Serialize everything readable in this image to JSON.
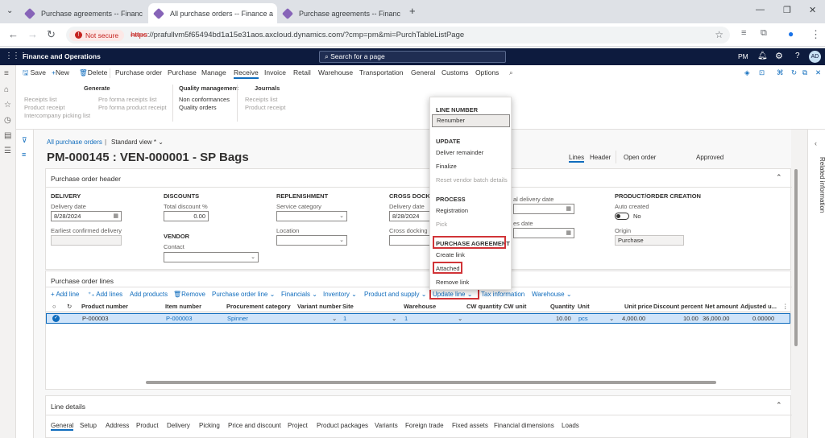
{
  "browser": {
    "tabs": [
      {
        "title": "Purchase agreements -- Financ"
      },
      {
        "title": "All purchase orders -- Finance a"
      },
      {
        "title": "Purchase agreements -- Financ"
      }
    ],
    "not_secure": "Not secure",
    "url_scheme": "https",
    "url_rest": "://prafullvm5f65494bd1a15e31aos.axcloud.dynamics.com/?cmp=pm&mi=PurchTableListPage"
  },
  "appbar": {
    "title": "Finance and Operations",
    "search_placeholder": "Search for a page",
    "company": "PM",
    "avatar": "AD"
  },
  "actions": {
    "save": "Save",
    "new": "New",
    "delete": "Delete",
    "tabs": [
      "Purchase order",
      "Purchase",
      "Manage",
      "Receive",
      "Invoice",
      "Retail",
      "Warehouse",
      "Transportation",
      "General",
      "Customs",
      "Options"
    ],
    "selected_tab": "Receive"
  },
  "ribbon": {
    "generate": {
      "title": "Generate",
      "items": [
        "Receipts list",
        "Product receipt",
        "Intercompany picking list",
        "Pro forma receipts list",
        "Pro forma product receipt"
      ]
    },
    "quality": {
      "title": "Quality management",
      "items": [
        "Non conformances",
        "Quality orders"
      ]
    },
    "journals": {
      "title": "Journals",
      "items": [
        "Receipts list",
        "Product receipt"
      ]
    }
  },
  "page": {
    "breadcrumb": "All purchase orders",
    "view": "Standard view *",
    "title": "PM-000145 : VEN-000001 - SP Bags",
    "view_lines": "Lines",
    "view_header": "Header",
    "status_open": "Open order",
    "status_approved": "Approved"
  },
  "header_section": {
    "title": "Purchase order header",
    "delivery": {
      "title": "DELIVERY",
      "date_label": "Delivery date",
      "date_value": "8/28/2024",
      "earliest_label": "Earliest confirmed delivery"
    },
    "discounts": {
      "title": "DISCOUNTS",
      "total_label": "Total discount %",
      "total_value": "0.00"
    },
    "vendor": {
      "title": "VENDOR",
      "contact_label": "Contact"
    },
    "replenishment": {
      "title": "REPLENISHMENT",
      "service_label": "Service category",
      "location_label": "Location"
    },
    "crossdock": {
      "title": "CROSS DOCKING",
      "date_label": "Delivery date",
      "date_value": "8/28/2024",
      "cd_label": "Cross docking d"
    },
    "confirmed": {
      "label1": "al delivery date",
      "label2": "es date"
    },
    "creation": {
      "title": "PRODUCT/ORDER CREATION",
      "auto_label": "Auto created",
      "auto_value": "No",
      "origin_label": "Origin",
      "origin_value": "Purchase"
    }
  },
  "lines_section": {
    "title": "Purchase order lines",
    "toolbar": [
      "Add line",
      "Add lines",
      "Add products",
      "Remove",
      "Purchase order line",
      "Financials",
      "Inventory",
      "Product and supply",
      "Update line",
      "Tax information",
      "Warehouse"
    ],
    "columns": [
      "Product number",
      "Item number",
      "Procurement category",
      "Variant number",
      "Site",
      "Warehouse",
      "CW quantity",
      "CW unit",
      "Quantity",
      "Unit",
      "Unit price",
      "Discount percent",
      "Net amount",
      "Adjusted u..."
    ],
    "rows": [
      {
        "product": "P-000003",
        "item": "P-000003",
        "category": "Spinner",
        "variant": "",
        "site": "1",
        "warehouse": "1",
        "cw_qty": "",
        "cw_unit": "",
        "qty": "10.00",
        "unit": "pcs",
        "price": "4,000.00",
        "discount": "10.00",
        "net": "36,000.00",
        "adjusted": "0.00000"
      }
    ]
  },
  "line_details": {
    "title": "Line details",
    "tabs": [
      "General",
      "Setup",
      "Address",
      "Product",
      "Delivery",
      "Picking",
      "Price and discount",
      "Project",
      "Product packages",
      "Variants",
      "Foreign trade",
      "Fixed assets",
      "Financial dimensions",
      "Loads"
    ]
  },
  "flyout": {
    "h1": "LINE NUMBER",
    "renumber": "Renumber",
    "h2": "UPDATE",
    "deliver": "Deliver remainder",
    "finalize": "Finalize",
    "reset": "Reset vendor batch details",
    "h3": "PROCESS",
    "registration": "Registration",
    "pick": "Pick",
    "h4": "PURCHASE AGREEMENT",
    "create_link": "Create link",
    "attached": "Attached",
    "remove_link": "Remove link"
  },
  "right_panel": "Related information",
  "colors": {
    "accent": "#0f6cbd",
    "appbar": "#0d1b3e",
    "highlight": "#d13438"
  }
}
